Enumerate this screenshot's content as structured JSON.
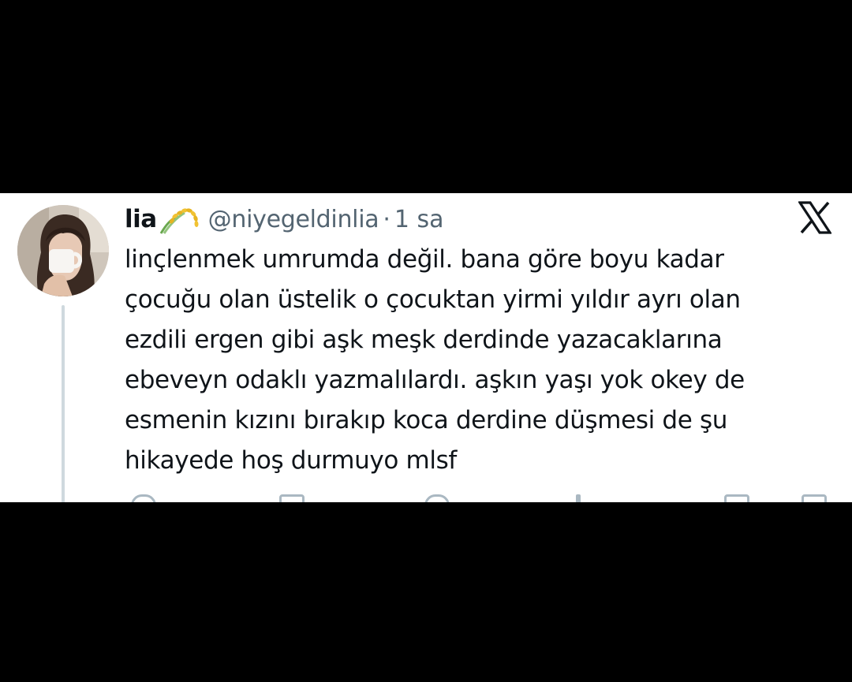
{
  "tweet": {
    "display_name": "lia",
    "name_emoji": "rice-sheaf-emoji",
    "handle": "@niyegeldinlia",
    "separator": "·",
    "time": "1 sa",
    "text_lines": [
      "linçlenmek umrumda değil. bana göre boyu kadar",
      "çocuğu olan üstelik o çocuktan yirmi yıldır ayrı olan",
      "ezdili ergen gibi aşk meşk derdinde yazacaklarına",
      "ebeveyn odaklı yazmalılardı. aşkın yaşı yok okey de",
      "esmenin kızını bırakıp koca derdine düşmesi de şu",
      "hikayede hoş durmuyo mlsf"
    ]
  },
  "icons": {
    "platform_logo": "x-logo-icon",
    "actions": [
      "reply-icon",
      "repost-icon",
      "like-icon",
      "views-icon",
      "bookmark-icon",
      "share-icon"
    ]
  },
  "colors": {
    "background": "#000000",
    "card": "#ffffff",
    "text_primary": "#0f1419",
    "text_secondary": "#536471",
    "thread_line": "#cfd9de"
  }
}
